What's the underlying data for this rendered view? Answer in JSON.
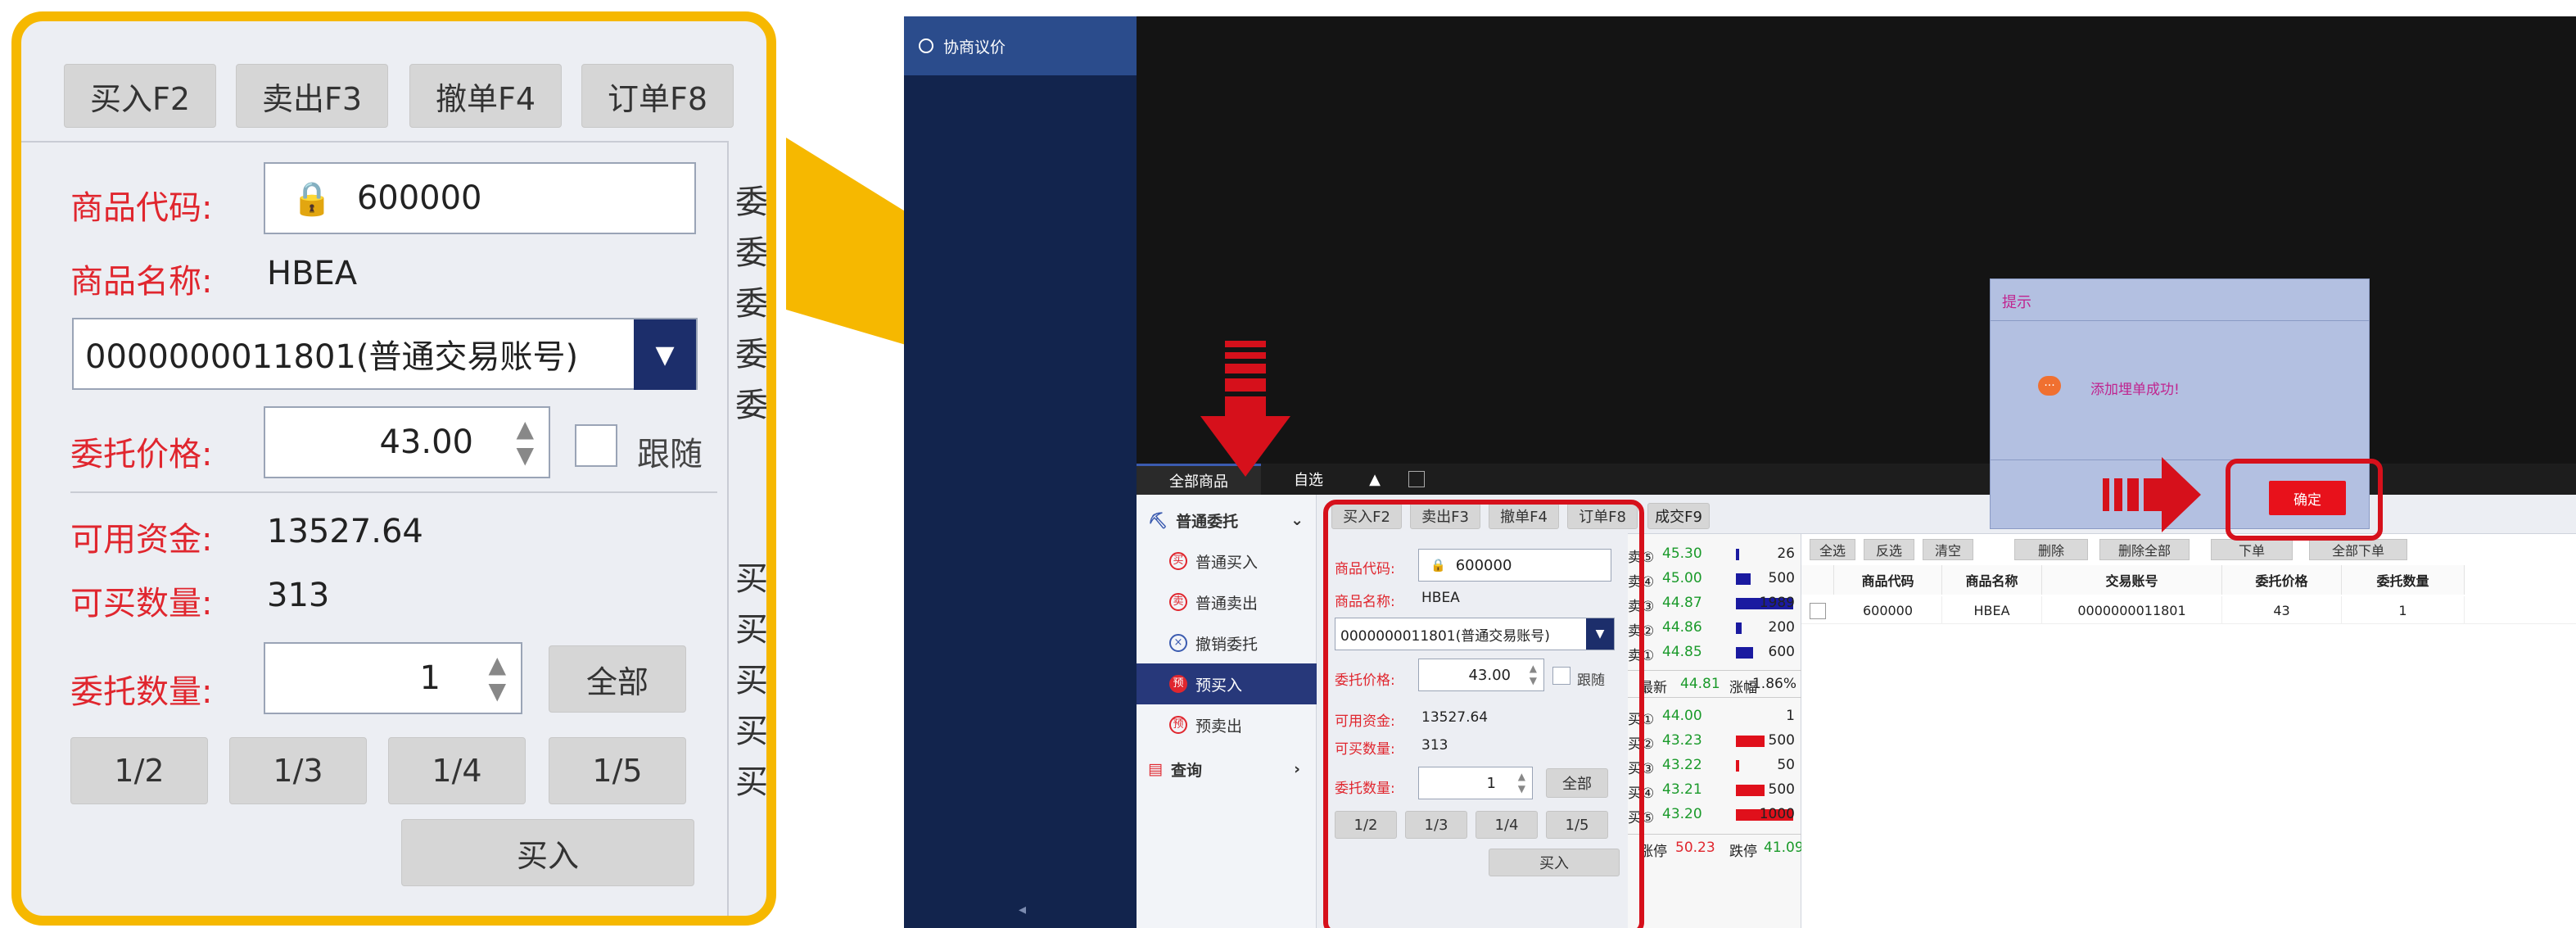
{
  "zoom": {
    "buttons": [
      "买入F2",
      "卖出F3",
      "撤单F4",
      "订单F8"
    ],
    "code_label": "商品代码:",
    "code_value": "600000",
    "name_label": "商品名称:",
    "name_value": "HBEA",
    "account_value": "0000000011801(普通交易账号)",
    "price_label": "委托价格:",
    "price_value": "43.00",
    "follow_label": "跟随",
    "funds_label": "可用资金:",
    "funds_value": "13527.64",
    "qty_avail_label": "可买数量:",
    "qty_avail_value": "313",
    "qty_label": "委托数量:",
    "qty_value": "1",
    "all_label": "全部",
    "fractions": [
      "1/2",
      "1/3",
      "1/4",
      "1/5"
    ],
    "buy_label": "买入",
    "clipped_right_glyphs": [
      "委",
      "委",
      "委",
      "委",
      "委",
      "买",
      "买",
      "买",
      "买",
      "买"
    ]
  },
  "app": {
    "title": "协商议价",
    "tabs": [
      "全部商品",
      "自选"
    ],
    "menu": [
      {
        "label": "普通委托",
        "suffix": "⌄"
      },
      {
        "label": "普通买入"
      },
      {
        "label": "普通卖出"
      },
      {
        "label": "撤销委托"
      },
      {
        "label": "预买入"
      },
      {
        "label": "预卖出"
      },
      {
        "label": "查询",
        "suffix": "›"
      }
    ],
    "order_tabs": [
      "买入F2",
      "卖出F3",
      "撤单F4",
      "订单F8",
      "成交F9"
    ],
    "order": {
      "code_label": "商品代码:",
      "code_value": "600000",
      "name_label": "商品名称:",
      "name_value": "HBEA",
      "account_value": "0000000011801(普通交易账号)",
      "price_label": "委托价格:",
      "price_value": "43.00",
      "follow_label": "跟随",
      "funds_label": "可用资金:",
      "funds_value": "13527.64",
      "qty_avail_label": "可买数量:",
      "qty_avail_value": "313",
      "qty_label": "委托数量:",
      "qty_value": "1",
      "all_label": "全部",
      "fractions": [
        "1/2",
        "1/3",
        "1/4",
        "1/5"
      ],
      "buy_label": "买入"
    },
    "book": {
      "asks": [
        {
          "label": "卖⑤",
          "price": "45.30",
          "qty": "26",
          "level": 0.01
        },
        {
          "label": "卖④",
          "price": "45.00",
          "qty": "500",
          "level": 0.25
        },
        {
          "label": "卖③",
          "price": "44.87",
          "qty": "1989",
          "level": 1.0
        },
        {
          "label": "卖②",
          "price": "44.86",
          "qty": "200",
          "level": 0.1
        },
        {
          "label": "卖①",
          "price": "44.85",
          "qty": "600",
          "level": 0.3
        }
      ],
      "last_label": "最新",
      "last_value": "44.81",
      "change_label": "涨幅",
      "change_value": "-1.86%",
      "bids": [
        {
          "label": "买①",
          "price": "44.00",
          "qty": "1",
          "level": 0.0
        },
        {
          "label": "买②",
          "price": "43.23",
          "qty": "500",
          "level": 0.5
        },
        {
          "label": "买③",
          "price": "43.22",
          "qty": "50",
          "level": 0.05
        },
        {
          "label": "买④",
          "price": "43.21",
          "qty": "500",
          "level": 0.5
        },
        {
          "label": "买⑤",
          "price": "43.20",
          "qty": "1000",
          "level": 1.0
        }
      ],
      "limit_up_label": "涨停",
      "limit_up_value": "50.23",
      "limit_down_label": "跌停",
      "limit_down_value": "41.09"
    },
    "grid": {
      "actions": [
        "全选",
        "反选",
        "清空",
        "删除",
        "删除全部",
        "下单",
        "全部下单"
      ],
      "headers": [
        "商品代码",
        "商品名称",
        "交易账号",
        "委托价格",
        "委托数量"
      ],
      "rows": [
        [
          "600000",
          "HBEA",
          "0000000011801",
          "43",
          "1"
        ]
      ]
    },
    "dialog": {
      "title": "提示",
      "message": "添加埋单成功!",
      "ok_label": "确定"
    }
  },
  "colors": {
    "callout": "#f6b800",
    "highlight": "#d6101b",
    "label_red": "#e0262e",
    "ask_bar": "#1a1aa0",
    "bid_bar": "#e0101b",
    "nav": "#12244d"
  }
}
